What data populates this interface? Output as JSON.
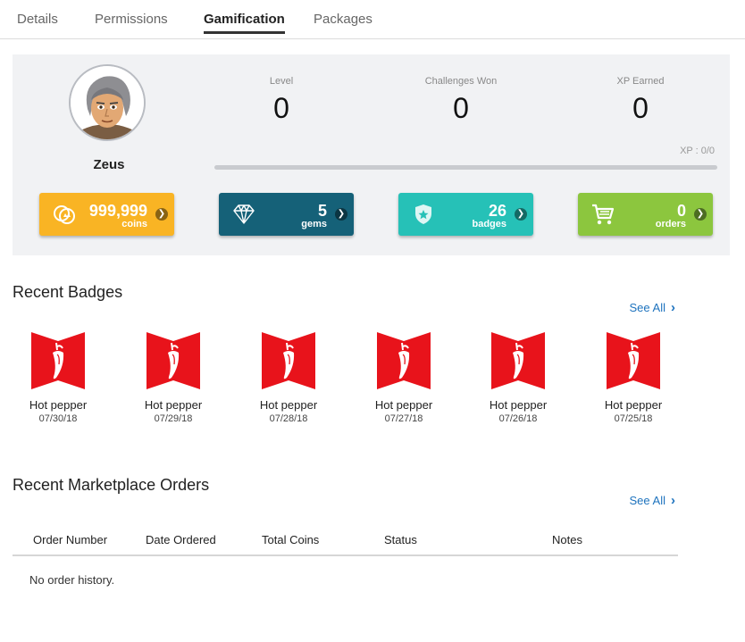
{
  "tabs": [
    {
      "label": "Details"
    },
    {
      "label": "Permissions"
    },
    {
      "label": "Gamification",
      "active": true
    },
    {
      "label": "Packages"
    }
  ],
  "profile": {
    "name": "Zeus",
    "avatar_icon": "cartoon-avatar-grey-hair"
  },
  "stats": [
    {
      "label": "Level",
      "value": "0"
    },
    {
      "label": "Challenges Won",
      "value": "0"
    },
    {
      "label": "XP Earned",
      "value": "0"
    }
  ],
  "xp": {
    "text": "XP : 0/0",
    "progress": 0
  },
  "cards": [
    {
      "value": "999,999",
      "unit": "coins",
      "icon": "coins-icon",
      "color": "#f9b424"
    },
    {
      "value": "5",
      "unit": "gems",
      "icon": "diamond-icon",
      "color": "#156178"
    },
    {
      "value": "26",
      "unit": "badges",
      "icon": "shield-star-icon",
      "color": "#26c1b7"
    },
    {
      "value": "0",
      "unit": "orders",
      "icon": "cart-icon",
      "color": "#8cc63e"
    }
  ],
  "recent_badges": {
    "title": "Recent Badges",
    "see_all": "See All",
    "items": [
      {
        "name": "Hot pepper",
        "date": "07/30/18"
      },
      {
        "name": "Hot pepper",
        "date": "07/29/18"
      },
      {
        "name": "Hot pepper",
        "date": "07/28/18"
      },
      {
        "name": "Hot pepper",
        "date": "07/27/18"
      },
      {
        "name": "Hot pepper",
        "date": "07/26/18"
      },
      {
        "name": "Hot pepper",
        "date": "07/25/18"
      }
    ]
  },
  "orders": {
    "title": "Recent Marketplace Orders",
    "see_all": "See All",
    "columns": [
      "Order Number",
      "Date Ordered",
      "Total Coins",
      "Status",
      "Notes"
    ],
    "empty_text": "No order history."
  },
  "colors": {
    "badge_red": "#e8131b",
    "link_blue": "#1e73be",
    "xp_fill": "#7cbf3a"
  }
}
